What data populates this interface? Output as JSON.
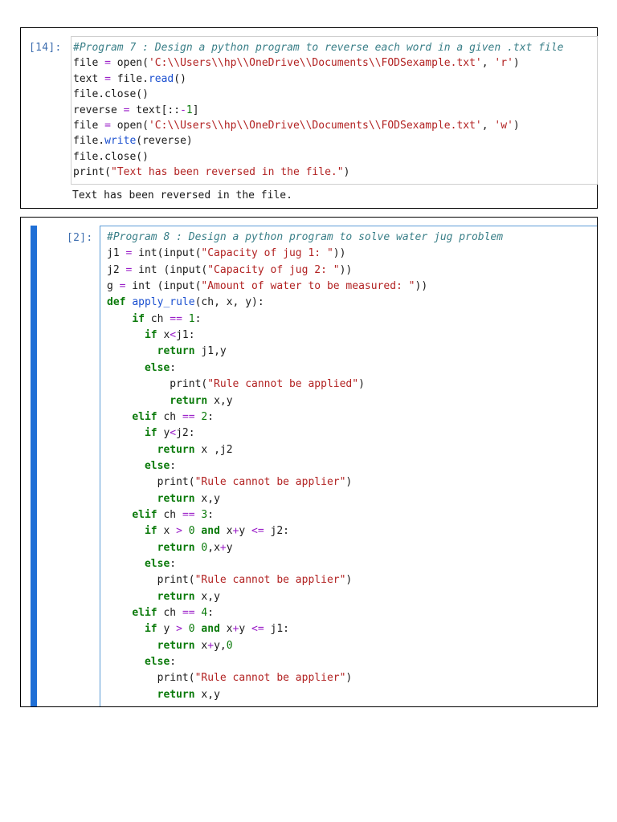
{
  "cell1": {
    "prompt": "[14]:",
    "code": [
      "#Program 7 : Design a python program to reverse each word in a given .txt file",
      "file = open('C:\\\\Users\\\\hp\\\\OneDrive\\\\Documents\\\\FODSexample.txt', 'r')",
      "text = file.read()",
      "file.close()",
      "reverse = text[::-1]",
      "file = open('C:\\\\Users\\\\hp\\\\OneDrive\\\\Documents\\\\FODSexample.txt', 'w')",
      "file.write(reverse)",
      "file.close()",
      "print(\"Text has been reversed in the file.\")"
    ],
    "output": "Text has been reversed in the file."
  },
  "cell2": {
    "prompt": "[2]:",
    "code": [
      "#Program 8 : Design a python program to solve water jug problem",
      "j1 = int(input(\"Capacity of jug 1: \"))",
      "j2 = int (input(\"Capacity of jug 2: \"))",
      "g = int (input(\"Amount of water to be measured: \"))",
      "def apply_rule(ch, x, y):",
      "    if ch == 1:",
      "      if x<j1:",
      "        return j1,y",
      "      else:",
      "          print(\"Rule cannot be applied\")",
      "          return x,y",
      "    elif ch == 2:",
      "      if y<j2:",
      "        return x ,j2",
      "      else:",
      "        print(\"Rule cannot be applier\")",
      "        return x,y",
      "    elif ch == 3:",
      "      if x > 0 and x+y <= j2:",
      "        return 0,x+y",
      "      else:",
      "        print(\"Rule cannot be applier\")",
      "        return x,y",
      "    elif ch == 4:",
      "      if y > 0 and x+y <= j1:",
      "        return x+y,0",
      "      else:",
      "        print(\"Rule cannot be applier\")",
      "        return x,y"
    ]
  },
  "colors": {
    "prompt": "#3f6fb0",
    "comment": "#3a7f88",
    "string": "#b22222",
    "keyword": "#0a7a0a",
    "operator": "#9b20c8",
    "selected_bar": "#1f6fd6",
    "active_border": "#5a9ad6"
  }
}
